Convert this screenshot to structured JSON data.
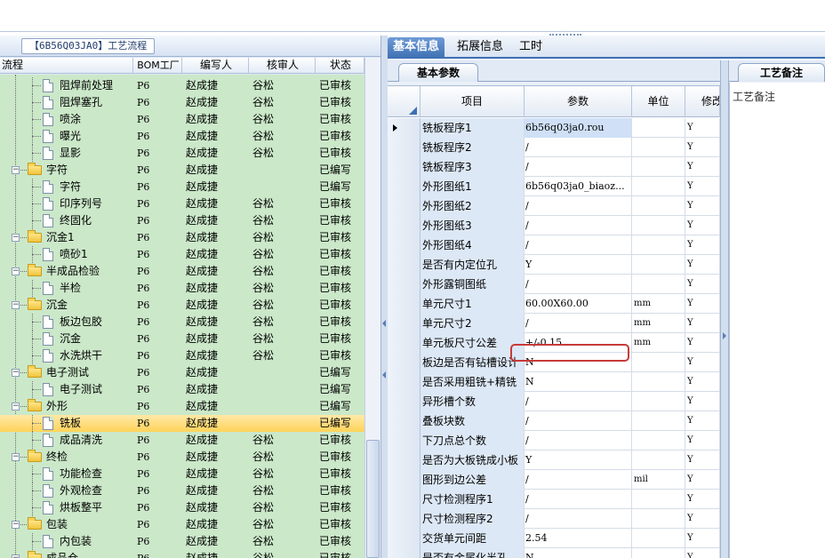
{
  "left_panel": {
    "title_tab": "【6B56Q03JA0】工艺流程",
    "columns": [
      "流程",
      "BOM工厂",
      "编写人",
      "核审人",
      "状态"
    ],
    "rows": [
      {
        "level": 2,
        "kind": "doc",
        "name": "阻焊前处理",
        "bom": "P6",
        "writer": "赵成捷",
        "reviewer": "谷松",
        "status": "已审核"
      },
      {
        "level": 2,
        "kind": "doc",
        "name": "阻焊塞孔",
        "bom": "P6",
        "writer": "赵成捷",
        "reviewer": "谷松",
        "status": "已审核"
      },
      {
        "level": 2,
        "kind": "doc",
        "name": "喷涂",
        "bom": "P6",
        "writer": "赵成捷",
        "reviewer": "谷松",
        "status": "已审核"
      },
      {
        "level": 2,
        "kind": "doc",
        "name": "曝光",
        "bom": "P6",
        "writer": "赵成捷",
        "reviewer": "谷松",
        "status": "已审核"
      },
      {
        "level": 2,
        "kind": "doc",
        "name": "显影",
        "bom": "P6",
        "writer": "赵成捷",
        "reviewer": "谷松",
        "status": "已审核"
      },
      {
        "level": 1,
        "kind": "folder",
        "name": "字符",
        "bom": "P6",
        "writer": "赵成捷",
        "reviewer": "",
        "status": "已编写"
      },
      {
        "level": 2,
        "kind": "doc",
        "name": "字符",
        "bom": "P6",
        "writer": "赵成捷",
        "reviewer": "",
        "status": "已编写"
      },
      {
        "level": 2,
        "kind": "doc",
        "name": "印序列号",
        "bom": "P6",
        "writer": "赵成捷",
        "reviewer": "谷松",
        "status": "已审核"
      },
      {
        "level": 2,
        "kind": "doc",
        "name": "终固化",
        "bom": "P6",
        "writer": "赵成捷",
        "reviewer": "谷松",
        "status": "已审核"
      },
      {
        "level": 1,
        "kind": "folder",
        "name": "沉金1",
        "bom": "P6",
        "writer": "赵成捷",
        "reviewer": "谷松",
        "status": "已审核"
      },
      {
        "level": 2,
        "kind": "doc",
        "name": "喷砂1",
        "bom": "P6",
        "writer": "赵成捷",
        "reviewer": "谷松",
        "status": "已审核"
      },
      {
        "level": 1,
        "kind": "folder",
        "name": "半成品检验",
        "bom": "P6",
        "writer": "赵成捷",
        "reviewer": "谷松",
        "status": "已审核"
      },
      {
        "level": 2,
        "kind": "doc",
        "name": "半检",
        "bom": "P6",
        "writer": "赵成捷",
        "reviewer": "谷松",
        "status": "已审核"
      },
      {
        "level": 1,
        "kind": "folder",
        "name": "沉金",
        "bom": "P6",
        "writer": "赵成捷",
        "reviewer": "谷松",
        "status": "已审核"
      },
      {
        "level": 2,
        "kind": "doc",
        "name": "板边包胶",
        "bom": "P6",
        "writer": "赵成捷",
        "reviewer": "谷松",
        "status": "已审核"
      },
      {
        "level": 2,
        "kind": "doc",
        "name": "沉金",
        "bom": "P6",
        "writer": "赵成捷",
        "reviewer": "谷松",
        "status": "已审核"
      },
      {
        "level": 2,
        "kind": "doc",
        "name": "水洗烘干",
        "bom": "P6",
        "writer": "赵成捷",
        "reviewer": "谷松",
        "status": "已审核"
      },
      {
        "level": 1,
        "kind": "folder",
        "name": "电子测试",
        "bom": "P6",
        "writer": "赵成捷",
        "reviewer": "",
        "status": "已编写"
      },
      {
        "level": 2,
        "kind": "doc",
        "name": "电子测试",
        "bom": "P6",
        "writer": "赵成捷",
        "reviewer": "",
        "status": "已编写"
      },
      {
        "level": 1,
        "kind": "folder",
        "name": "外形",
        "bom": "P6",
        "writer": "赵成捷",
        "reviewer": "",
        "status": "已编写"
      },
      {
        "level": 2,
        "kind": "doc",
        "name": "铣板",
        "bom": "P6",
        "writer": "赵成捷",
        "reviewer": "",
        "status": "已编写",
        "selected": true
      },
      {
        "level": 2,
        "kind": "doc",
        "name": "成品清洗",
        "bom": "P6",
        "writer": "赵成捷",
        "reviewer": "谷松",
        "status": "已审核"
      },
      {
        "level": 1,
        "kind": "folder",
        "name": "终检",
        "bom": "P6",
        "writer": "赵成捷",
        "reviewer": "谷松",
        "status": "已审核"
      },
      {
        "level": 2,
        "kind": "doc",
        "name": "功能检查",
        "bom": "P6",
        "writer": "赵成捷",
        "reviewer": "谷松",
        "status": "已审核"
      },
      {
        "level": 2,
        "kind": "doc",
        "name": "外观检查",
        "bom": "P6",
        "writer": "赵成捷",
        "reviewer": "谷松",
        "status": "已审核"
      },
      {
        "level": 2,
        "kind": "doc",
        "name": "烘板整平",
        "bom": "P6",
        "writer": "赵成捷",
        "reviewer": "谷松",
        "status": "已审核"
      },
      {
        "level": 1,
        "kind": "folder",
        "name": "包装",
        "bom": "P6",
        "writer": "赵成捷",
        "reviewer": "谷松",
        "status": "已审核"
      },
      {
        "level": 2,
        "kind": "doc",
        "name": "内包装",
        "bom": "P6",
        "writer": "赵成捷",
        "reviewer": "谷松",
        "status": "已审核"
      },
      {
        "level": 1,
        "kind": "folder",
        "name": "成品仓",
        "bom": "P6",
        "writer": "赵成捷",
        "reviewer": "谷松",
        "status": "已审核"
      }
    ]
  },
  "tabs": [
    "基本信息",
    "拓展信息",
    "工时"
  ],
  "basic_params": {
    "subtab": "基本参数",
    "columns": [
      "项目",
      "参数",
      "单位",
      "修改"
    ],
    "rows": [
      {
        "item": "铣板程序1",
        "param": "6b56q03ja0.rou",
        "unit": "",
        "mod": "Y",
        "current": true
      },
      {
        "item": "铣板程序2",
        "param": "/",
        "unit": "",
        "mod": "Y"
      },
      {
        "item": "铣板程序3",
        "param": "/",
        "unit": "",
        "mod": "Y"
      },
      {
        "item": "外形图纸1",
        "param": "6b56q03ja0_biaoz...",
        "unit": "",
        "mod": "Y"
      },
      {
        "item": "外形图纸2",
        "param": "/",
        "unit": "",
        "mod": "Y"
      },
      {
        "item": "外形图纸3",
        "param": "/",
        "unit": "",
        "mod": "Y"
      },
      {
        "item": "外形图纸4",
        "param": "/",
        "unit": "",
        "mod": "Y"
      },
      {
        "item": "是否有内定位孔",
        "param": "Y",
        "unit": "",
        "mod": "Y"
      },
      {
        "item": "外形露铜图纸",
        "param": "/",
        "unit": "",
        "mod": "Y"
      },
      {
        "item": "单元尺寸1",
        "param": "60.00X60.00",
        "unit": "mm",
        "mod": "Y",
        "highlight": true
      },
      {
        "item": "单元尺寸2",
        "param": "/",
        "unit": "mm",
        "mod": "Y"
      },
      {
        "item": "单元板尺寸公差",
        "param": "+/-0.15",
        "unit": "mm",
        "mod": "Y"
      },
      {
        "item": "板边是否有钻槽设计",
        "param": "N",
        "unit": "",
        "mod": "Y"
      },
      {
        "item": "是否采用粗铣+精铣",
        "param": "N",
        "unit": "",
        "mod": "Y"
      },
      {
        "item": "异形槽个数",
        "param": "/",
        "unit": "",
        "mod": "Y"
      },
      {
        "item": "叠板块数",
        "param": "/",
        "unit": "",
        "mod": "Y"
      },
      {
        "item": "下刀点总个数",
        "param": "/",
        "unit": "",
        "mod": "Y"
      },
      {
        "item": "是否为大板铣成小板",
        "param": "Y",
        "unit": "",
        "mod": "Y"
      },
      {
        "item": "图形到边公差",
        "param": "/",
        "unit": "mil",
        "mod": "Y"
      },
      {
        "item": "尺寸检测程序1",
        "param": "/",
        "unit": "",
        "mod": "Y"
      },
      {
        "item": "尺寸检测程序2",
        "param": "/",
        "unit": "",
        "mod": "Y"
      },
      {
        "item": "交货单元间距",
        "param": "2.54",
        "unit": "",
        "mod": "Y"
      },
      {
        "item": "是否有金属化半孔",
        "param": "N",
        "unit": "",
        "mod": "Y"
      }
    ]
  },
  "notes": {
    "subtab": "工艺备注",
    "label": "工艺备注"
  },
  "colors": {
    "tree_bg": "#cbe8c9",
    "selected": "#ffd35a",
    "accent": "#3d6fb2",
    "highlight_border": "#c93a3a"
  }
}
